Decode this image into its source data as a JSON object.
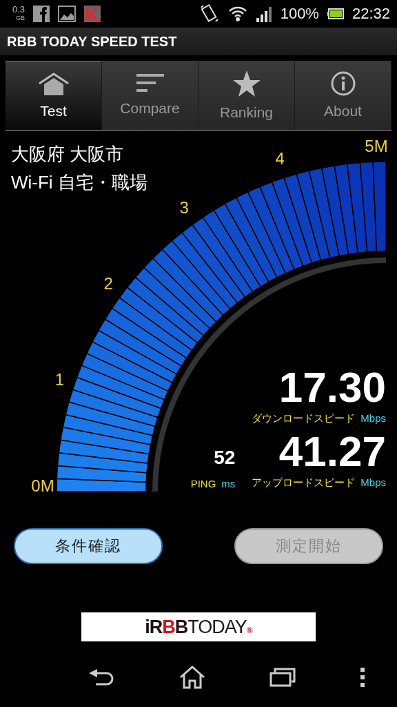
{
  "status_bar": {
    "data_usage": "0.3",
    "data_unit": "GB",
    "battery_text": "100%",
    "time": "22:32"
  },
  "app_bar": {
    "title": "RBB TODAY SPEED TEST"
  },
  "tabs": [
    {
      "label": "Test",
      "selected": true
    },
    {
      "label": "Compare",
      "selected": false
    },
    {
      "label": "Ranking",
      "selected": false
    },
    {
      "label": "About",
      "selected": false
    }
  ],
  "location": {
    "region": "大阪府 大阪市",
    "connection": "Wi-Fi 自宅・職場"
  },
  "gauge": {
    "scale_labels": [
      "0M",
      "1",
      "2",
      "3",
      "4",
      "5M"
    ]
  },
  "download": {
    "value": "17.30",
    "label": "ダウンロードスピード",
    "unit": "Mbps"
  },
  "ping": {
    "value": "52",
    "label": "PING",
    "unit": "ms"
  },
  "upload": {
    "value": "41.27",
    "label": "アップロードスピード",
    "unit": "Mbps"
  },
  "buttons": [
    {
      "label": "条件確認",
      "disabled": false
    },
    {
      "label": "測定開始",
      "disabled": true
    }
  ],
  "banner": {
    "logo": [
      "iR",
      "B",
      "B",
      "TODAY",
      "®"
    ]
  }
}
